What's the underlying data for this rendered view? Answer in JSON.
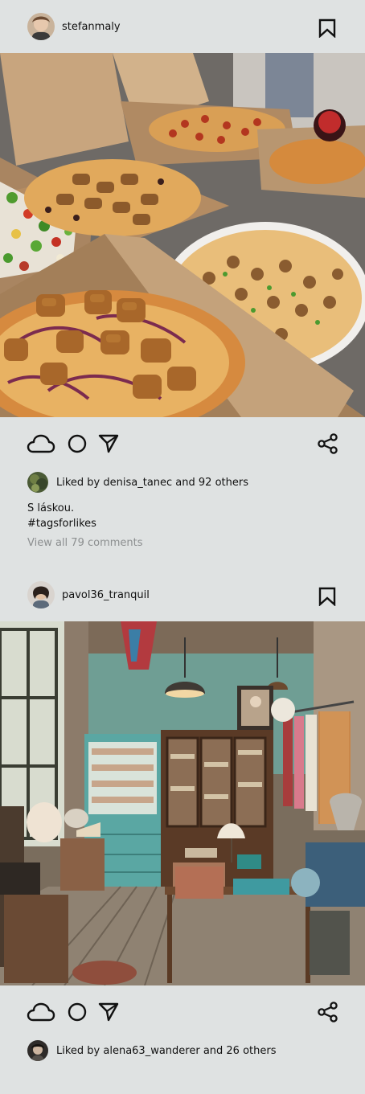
{
  "posts": [
    {
      "username": "stefanmaly",
      "likes_text": "Liked by denisa_tanec and 92 others",
      "caption_line1": "S láskou.",
      "caption_line2": "#tagsforlikes",
      "view_comments": "View all 79 comments",
      "image_description": "pizza-boxes-photo"
    },
    {
      "username": "pavol36_tranquil",
      "likes_text": "Liked by alena63_wanderer and 26 others",
      "image_description": "vintage-shop-photo"
    }
  ],
  "icons": {
    "save": "bookmark-icon",
    "like": "cloud-icon",
    "comment": "circle-icon",
    "share_send": "send-icon",
    "share": "share-icon"
  }
}
